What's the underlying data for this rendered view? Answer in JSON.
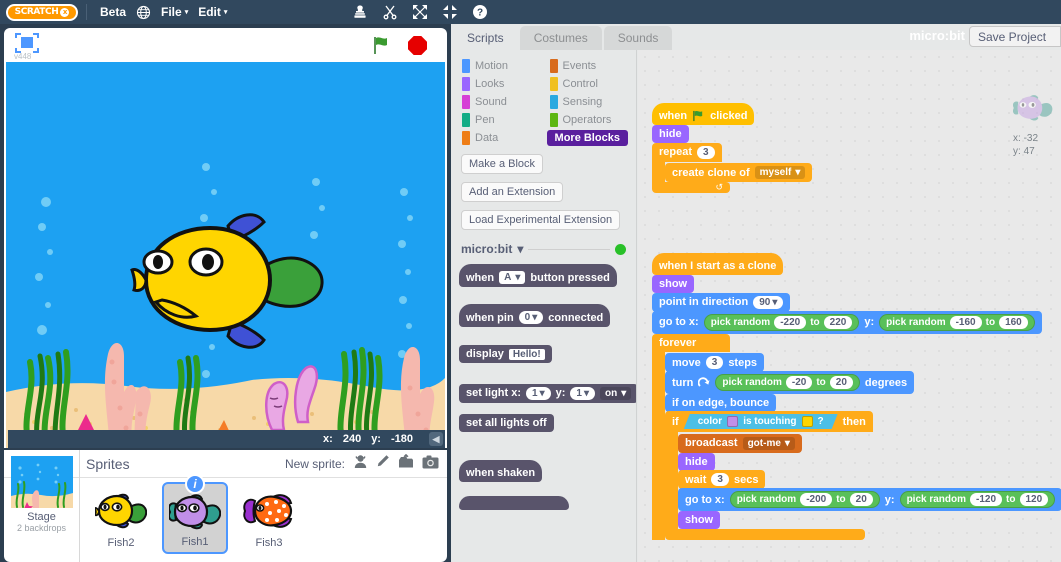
{
  "menubar": {
    "logo_text": "SCRATCH",
    "logo_x": "x",
    "beta": "Beta",
    "globe_icon": "globe-icon",
    "file": "File",
    "edit": "Edit",
    "caret": "▾",
    "tools": [
      "stamp-icon",
      "scissors-icon",
      "grow-icon",
      "shrink-icon",
      "help-icon"
    ]
  },
  "stage": {
    "version": "v448",
    "fullscreen_icon": "fullscreen-icon",
    "green_flag_icon": "green-flag-icon",
    "stop_icon": "stop-icon",
    "mouse_x_label": "x:",
    "mouse_x": "240",
    "mouse_y_label": "y:",
    "mouse_y": "-180",
    "collapse_icon": "◀",
    "water_color": "#1da1f2",
    "sand_color": "#f7d9a8"
  },
  "sprite_pane": {
    "stage_label": "Stage",
    "stage_sub": "2 backdrops",
    "sprites_label": "Sprites",
    "new_sprite_label": "New sprite:",
    "new_sprite_icons": [
      "sprite-library-icon",
      "paint-new-sprite-icon",
      "upload-sprite-icon",
      "camera-sprite-icon"
    ],
    "sprites": [
      {
        "name": "Fish2",
        "selected": false,
        "body": "#ffd500",
        "fin": "#3f51d5",
        "tail": "#3aa03a"
      },
      {
        "name": "Fish1",
        "selected": true,
        "body": "#c18fe8",
        "fin": "#2f9e8f",
        "tail": "#2f9e8f",
        "badge": "i"
      },
      {
        "name": "Fish3",
        "selected": false,
        "body": "#ff6a13",
        "fin": "#9b30d0",
        "tail": "#9b30d0"
      }
    ]
  },
  "editor": {
    "tabs": [
      {
        "label": "Scripts",
        "active": true
      },
      {
        "label": "Costumes",
        "active": false
      },
      {
        "label": "Sounds",
        "active": false
      }
    ],
    "project_title": "micro:bit",
    "save_label": "Save Project"
  },
  "palette": {
    "categories": [
      {
        "label": "Motion",
        "color": "#4c97ff",
        "active": false
      },
      {
        "label": "Events",
        "color": "#d86b1d",
        "active": false
      },
      {
        "label": "Looks",
        "color": "#9966ff",
        "active": false
      },
      {
        "label": "Control",
        "color": "#f0c020",
        "active": false
      },
      {
        "label": "Sound",
        "color": "#d63fd6",
        "active": false
      },
      {
        "label": "Sensing",
        "color": "#2aa9e0",
        "active": false
      },
      {
        "label": "Pen",
        "color": "#13ac86",
        "active": false
      },
      {
        "label": "Operators",
        "color": "#5cb712",
        "active": false
      },
      {
        "label": "Data",
        "color": "#ee7d16",
        "active": false
      },
      {
        "label": "More Blocks",
        "color": "#5a1f9e",
        "active": true
      }
    ],
    "buttons": [
      "Make a Block",
      "Add an Extension",
      "Load Experimental Extension"
    ],
    "extension": {
      "name": "micro:bit",
      "caret": "▾",
      "status_color": "#28c028"
    },
    "blocks": {
      "when_button": {
        "when": "when",
        "value": "A",
        "caret": "▾",
        "rest": "button pressed"
      },
      "when_pin": {
        "when": "when pin",
        "value": "0",
        "caret": "▾",
        "rest": "connected"
      },
      "display": {
        "label": "display",
        "value": "Hello!"
      },
      "set_light": {
        "label": "set light x:",
        "x": "1",
        "ylabel": "y:",
        "y": "1",
        "state": "on",
        "caret": "▾"
      },
      "set_all_off": {
        "label": "set all lights off"
      },
      "when_shaken": {
        "label": "when shaken"
      }
    }
  },
  "sprite_info": {
    "x_label": "x:",
    "x_value": "-32",
    "y_label": "y:",
    "y_value": "47"
  },
  "scripts": {
    "stack1": {
      "when_flag": {
        "when": "when",
        "flag_icon": "green-flag-icon",
        "clicked": "clicked"
      },
      "hide": "hide",
      "repeat": {
        "label": "repeat",
        "times": "3"
      },
      "create_clone": {
        "label": "create clone of",
        "target": "myself",
        "caret": "▾"
      },
      "loop_arrow": "↺"
    },
    "stack2": {
      "when_clone": "when I start as a clone",
      "show": "show",
      "point": {
        "label": "point in direction",
        "value": "90",
        "caret": "▾"
      },
      "goto": {
        "label": "go to x:",
        "x_random": {
          "label": "pick random",
          "from": "-220",
          "to_label": "to",
          "to": "220"
        },
        "ylabel": "y:",
        "y_random": {
          "label": "pick random",
          "from": "-160",
          "to_label": "to",
          "to": "160"
        }
      },
      "forever": "forever",
      "move": {
        "label": "move",
        "value": "3",
        "unit": "steps"
      },
      "turn": {
        "label": "turn",
        "icon": "turn-right-icon",
        "random": {
          "label": "pick random",
          "from": "-20",
          "to_label": "to",
          "to": "20"
        },
        "unit": "degrees"
      },
      "bounce": "if on edge, bounce",
      "if_block": {
        "if_label": "if",
        "then_label": "then",
        "condition": {
          "prefix": "color",
          "color1": "#c18fe8",
          "mid": "is touching",
          "color2": "#ffd500",
          "q": "?"
        }
      },
      "broadcast": {
        "label": "broadcast",
        "message": "got-me",
        "caret": "▾"
      },
      "hide": "hide",
      "wait": {
        "label": "wait",
        "value": "3",
        "unit": "secs"
      },
      "goto2": {
        "label": "go to x:",
        "x_random": {
          "label": "pick random",
          "from": "-200",
          "to_label": "to",
          "to": "20"
        },
        "ylabel": "y:",
        "y_random": {
          "label": "pick random",
          "from": "-120",
          "to_label": "to",
          "to": "120"
        }
      },
      "show2": "show"
    }
  }
}
